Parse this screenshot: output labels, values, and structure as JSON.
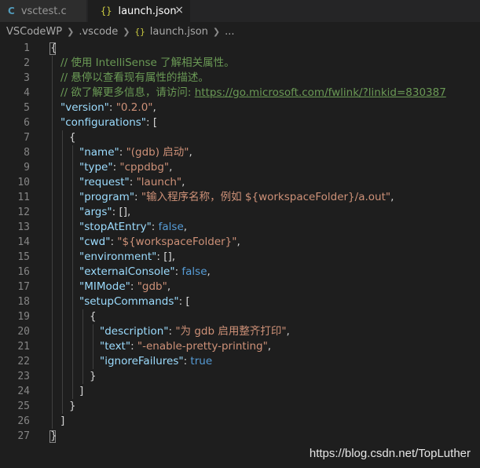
{
  "tabs": [
    {
      "icon": "C",
      "label": "vsctest.c",
      "active": false
    },
    {
      "icon": "{}",
      "label": "launch.json",
      "active": true,
      "close": "×"
    }
  ],
  "breadcrumb": {
    "items": [
      "VSCodeWP",
      ".vscode",
      "launch.json",
      "..."
    ],
    "json_icon": "{}"
  },
  "editor": {
    "line_numbers": [
      "1",
      "2",
      "3",
      "4",
      "5",
      "6",
      "7",
      "8",
      "9",
      "10",
      "11",
      "12",
      "13",
      "14",
      "15",
      "16",
      "17",
      "18",
      "19",
      "20",
      "21",
      "22",
      "23",
      "24",
      "25",
      "26",
      "27"
    ],
    "l1": "{",
    "l2": "// 使用 IntelliSense 了解相关属性。",
    "l3": "// 悬停以查看现有属性的描述。",
    "l4_text": "// 欲了解更多信息，请访问: ",
    "l4_link": "https://go.microsoft.com/fwlink/?linkid=830387",
    "l5_key": "\"version\"",
    "l5_val": "\"0.2.0\"",
    "l6_key": "\"configurations\"",
    "l7": "{",
    "l8_key": "\"name\"",
    "l8_val": "\"(gdb) 启动\"",
    "l9_key": "\"type\"",
    "l9_val": "\"cppdbg\"",
    "l10_key": "\"request\"",
    "l10_val": "\"launch\"",
    "l11_key": "\"program\"",
    "l11_val": "\"输入程序名称，例如 ${workspaceFolder}/a.out\"",
    "l12_key": "\"args\"",
    "l12_val": "[]",
    "l13_key": "\"stopAtEntry\"",
    "l13_val": "false",
    "l14_key": "\"cwd\"",
    "l14_val": "\"${workspaceFolder}\"",
    "l15_key": "\"environment\"",
    "l15_val": "[]",
    "l16_key": "\"externalConsole\"",
    "l16_val": "false",
    "l17_key": "\"MIMode\"",
    "l17_val": "\"gdb\"",
    "l18_key": "\"setupCommands\"",
    "l19": "{",
    "l20_key": "\"description\"",
    "l20_val": "\"为 gdb 启用整齐打印\"",
    "l21_key": "\"text\"",
    "l21_val": "\"-enable-pretty-printing\"",
    "l22_key": "\"ignoreFailures\"",
    "l22_val": "true",
    "l23": "}",
    "l24": "]",
    "l25": "}",
    "l26": "]",
    "l27": "}"
  },
  "watermark": "https://blog.csdn.net/TopLuther"
}
